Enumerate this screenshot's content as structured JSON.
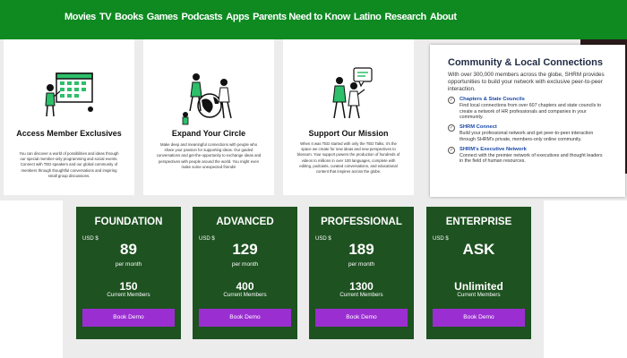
{
  "nav": {
    "items": [
      "Movies",
      "TV",
      "Books",
      "Games",
      "Podcasts",
      "Apps",
      "Parents Need to Know",
      "Latino",
      "Research",
      "About"
    ]
  },
  "features": [
    {
      "title": "Access Member Exclusives",
      "body": "You can discover a world of possibilities and ideas through our special member-only programming and social events. Connect with TED speakers and our global community of members through thoughtful conversations and inspiring small group discussions."
    },
    {
      "title": "Expand Your Circle",
      "body": "Make deep and meaningful connections with people who share your passion for supporting ideas. Our guided conversations and get-the-opportunity to exchange ideas and perspectives with people around the world. You might even make some unexpected friends!"
    },
    {
      "title": "Support Our Mission",
      "body": "When it was TED started with only the TED Talks, it's the space we create for new ideas and new perspectives to blossom. Your support powers the production of hundreds of videos to millions in over 100 languages, complete with editing, podcasts, curated conversations, and educational content that inspires across the globe."
    }
  ],
  "shrm": {
    "title": "Community & Local Connections",
    "intro": "With over 300,000 members across the globe, SHRM provides opportunities to build your network with exclusive peer-to-peer interaction.",
    "items": [
      {
        "title": "Chapters & State Councils",
        "body": "Find local connections from over 607 chapters and state councils to create a network of HR professionals and companies in your community."
      },
      {
        "title": "SHRM Connect",
        "body": "Build your professional network and get peer-to-peer interaction through SHRM's private, members-only online community."
      },
      {
        "title": "SHRM's Executive Network",
        "body": "Connect with the premier network of executives and thought leaders in the field of human resources."
      }
    ]
  },
  "plans": [
    {
      "name": "FOUNDATION",
      "currency": "USD $",
      "price": "89",
      "period": "per month",
      "members": "150",
      "members_label": "Current Members",
      "button": "Book Demo"
    },
    {
      "name": "ADVANCED",
      "currency": "USD $",
      "price": "129",
      "period": "per month",
      "members": "400",
      "members_label": "Current Members",
      "button": "Book Demo"
    },
    {
      "name": "PROFESSIONAL",
      "currency": "USD $",
      "price": "189",
      "period": "per month",
      "members": "1300",
      "members_label": "Current Members",
      "button": "Book Demo"
    },
    {
      "name": "ENTERPRISE",
      "currency": "USD $",
      "price": "ASK",
      "period": "",
      "members": "Unlimited",
      "members_label": "Current Members",
      "button": "Book Demo"
    }
  ],
  "colors": {
    "nav": "#0e8a21",
    "plan_card": "#1e5221",
    "button": "#9a2ed1",
    "link_blue": "#1a49a7"
  }
}
